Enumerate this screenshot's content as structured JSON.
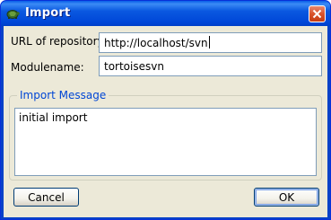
{
  "window": {
    "title": "Import",
    "icon": "tortoisesvn-icon",
    "close_icon": "close-icon"
  },
  "form": {
    "url_label": "URL of repository:",
    "url_value": "http://localhost/svn",
    "module_label": "Modulename:",
    "module_value": "tortoisesvn"
  },
  "message_group": {
    "legend": "Import Message",
    "text": "initial import"
  },
  "buttons": {
    "cancel_label": "Cancel",
    "ok_label": "OK"
  },
  "colors": {
    "titlebar": "#0a58e0",
    "dialog_bg": "#ece9d8",
    "group_legend": "#0046d5",
    "input_border": "#7f9db9",
    "close_button": "#d9532c"
  }
}
